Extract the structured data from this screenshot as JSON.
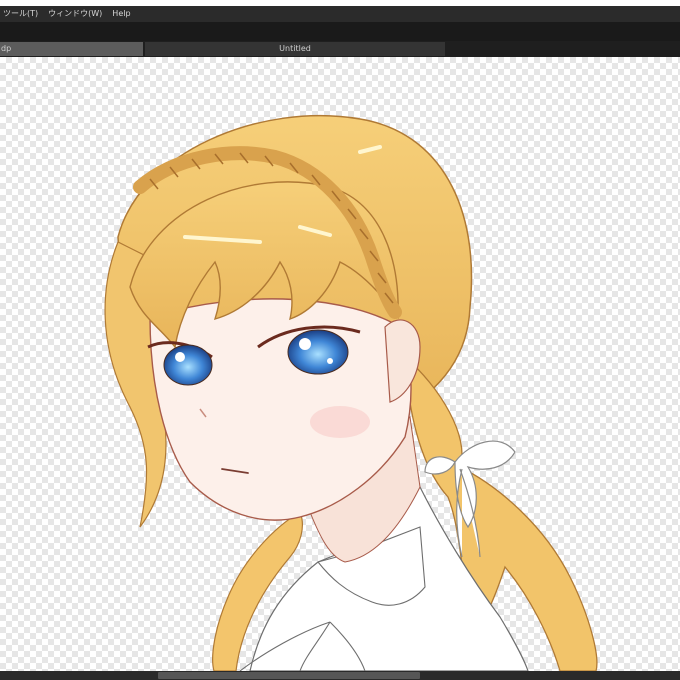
{
  "menubar": {
    "items": [
      {
        "label": "ツール(T)"
      },
      {
        "label": "ウィンドウ(W)"
      },
      {
        "label": "Help"
      }
    ]
  },
  "tabs": [
    {
      "label": "dp",
      "active": true
    },
    {
      "label": "Untitled",
      "active": false
    }
  ],
  "canvas": {
    "background": "transparent-checkerboard",
    "artwork": "anime girl with blonde braided hair, blue eyes, white ribbon"
  },
  "colors": {
    "menubar_bg": "#2b2b2b",
    "toolbar_bg": "#1a1a1a",
    "tab_active_bg": "#5c5c5c",
    "tab_inactive_bg": "#343434",
    "hair": "#f0c46a",
    "eyes": "#3f86d6",
    "skin": "#fdf2ec"
  }
}
